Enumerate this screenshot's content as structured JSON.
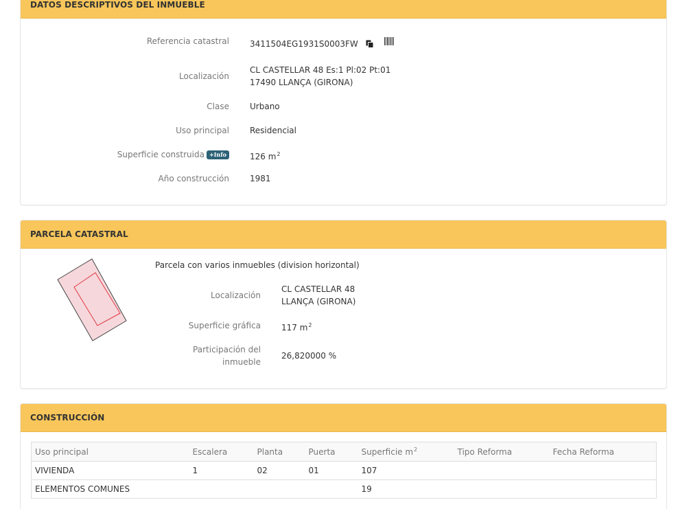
{
  "descriptive": {
    "title": "DATOS DESCRIPTIVOS DEL INMUEBLE",
    "ref_label": "Referencia catastral",
    "ref_value": "3411504EG1931S0003FW",
    "loc_label": "Localización",
    "loc_line1": "CL CASTELLAR 48 Es:1 Pl:02 Pt:01",
    "loc_line2": "17490 LLANÇA (GIRONA)",
    "class_label": "Clase",
    "class_value": "Urbano",
    "use_label": "Uso principal",
    "use_value": "Residencial",
    "surface_label": "Superficie construida",
    "info_badge": "+Info",
    "surface_value": "126 m",
    "surface_unit_sup": "2",
    "year_label": "Año construcción",
    "year_value": "1981",
    "icons": [
      "copy-icon",
      "barcode-icon"
    ]
  },
  "parcel": {
    "title": "PARCELA CATASTRAL",
    "description": "Parcela con varios inmuebles (division horizontal)",
    "loc_label": "Localización",
    "loc_line1": "CL CASTELLAR 48",
    "loc_line2": "LLANÇA (GIRONA)",
    "surface_label": "Superficie gráfica",
    "surface_value": "117 m",
    "surface_unit_sup": "2",
    "share_label_line1": "Participación del",
    "share_label_line2": "inmueble",
    "share_value": "26,820000 %",
    "map_colors": {
      "fill": "#f6d7dc",
      "outline": "#444444",
      "inner": "#e0393f"
    }
  },
  "construction": {
    "title": "CONSTRUCCIÓN",
    "columns": [
      "Uso principal",
      "Escalera",
      "Planta",
      "Puerta",
      "Superficie m",
      "Tipo Reforma",
      "Fecha Reforma"
    ],
    "surface_col_sup": "2",
    "rows": [
      [
        "VIVIENDA",
        "1",
        "02",
        "01",
        "107",
        "",
        ""
      ],
      [
        "ELEMENTOS COMUNES",
        "",
        "",
        "",
        "19",
        "",
        ""
      ]
    ]
  }
}
